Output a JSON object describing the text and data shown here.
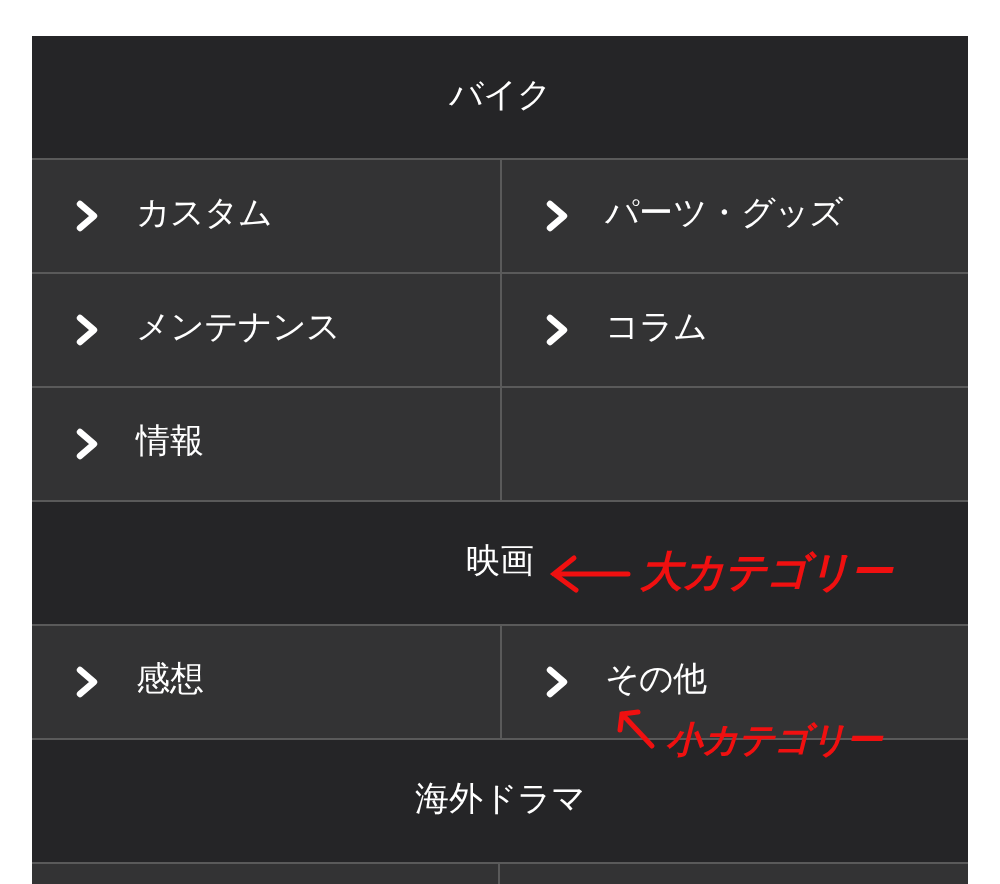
{
  "sections": [
    {
      "title": "バイク",
      "items": [
        "カスタム",
        "パーツ・グッズ",
        "メンテナンス",
        "コラム",
        "情報"
      ]
    },
    {
      "title": "映画",
      "items": [
        "感想",
        "その他"
      ]
    },
    {
      "title": "海外ドラマ",
      "continues": true
    }
  ],
  "annotations": [
    {
      "kind": "major",
      "text": "大カテゴリー"
    },
    {
      "kind": "minor",
      "text": "小カテゴリー"
    }
  ]
}
